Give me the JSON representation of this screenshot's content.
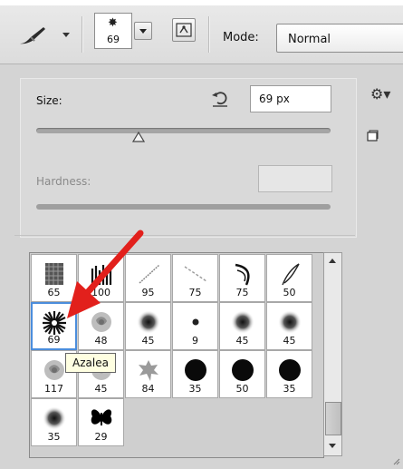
{
  "toolbar": {
    "tool_icon": "brush-icon",
    "preset_size": "69",
    "mode_label": "Mode:",
    "mode_value": "Normal",
    "panel_toggle_icon": "brush-panel-icon"
  },
  "panel": {
    "size_label": "Size:",
    "size_value": "69 px",
    "size_slider_fraction": 0.35,
    "hardness_label": "Hardness:",
    "hardness_value": "",
    "icons": [
      "reset-icon",
      "gear-icon",
      "new-preset-icon"
    ]
  },
  "brushes": [
    {
      "size": "65",
      "icon": "texture-brush",
      "selected": false
    },
    {
      "size": "100",
      "icon": "grass-brush",
      "selected": false
    },
    {
      "size": "95",
      "icon": "diagonal-line-brush",
      "selected": false
    },
    {
      "size": "75",
      "icon": "scatter-line-brush",
      "selected": false
    },
    {
      "size": "75",
      "icon": "feather-brush",
      "selected": false
    },
    {
      "size": "50",
      "icon": "leaf-brush",
      "selected": false
    },
    {
      "size": "69",
      "icon": "starburst-brush",
      "selected": true
    },
    {
      "size": "48",
      "icon": "rose-brush",
      "selected": false
    },
    {
      "size": "45",
      "icon": "soft-round-brush",
      "selected": false
    },
    {
      "size": "9",
      "icon": "small-round-brush",
      "selected": false
    },
    {
      "size": "45",
      "icon": "soft-round-brush",
      "selected": false
    },
    {
      "size": "45",
      "icon": "soft-round-brush",
      "selected": false
    },
    {
      "size": "117",
      "icon": "rose-brush",
      "selected": false
    },
    {
      "size": "45",
      "icon": "rose-brush",
      "selected": false
    },
    {
      "size": "84",
      "icon": "maple-leaf-brush",
      "selected": false
    },
    {
      "size": "35",
      "icon": "hard-round-brush",
      "selected": false
    },
    {
      "size": "50",
      "icon": "hard-round-brush",
      "selected": false
    },
    {
      "size": "35",
      "icon": "hard-round-brush",
      "selected": false
    },
    {
      "size": "35",
      "icon": "soft-round-brush",
      "selected": false
    },
    {
      "size": "29",
      "icon": "butterfly-brush",
      "selected": false
    }
  ],
  "tooltip": "Azalea",
  "scroll_position_fraction": 0.8,
  "colors": {
    "selection": "#4b8ddc",
    "annotation_arrow": "#e2201c",
    "tooltip_bg": "#ffffe1"
  }
}
